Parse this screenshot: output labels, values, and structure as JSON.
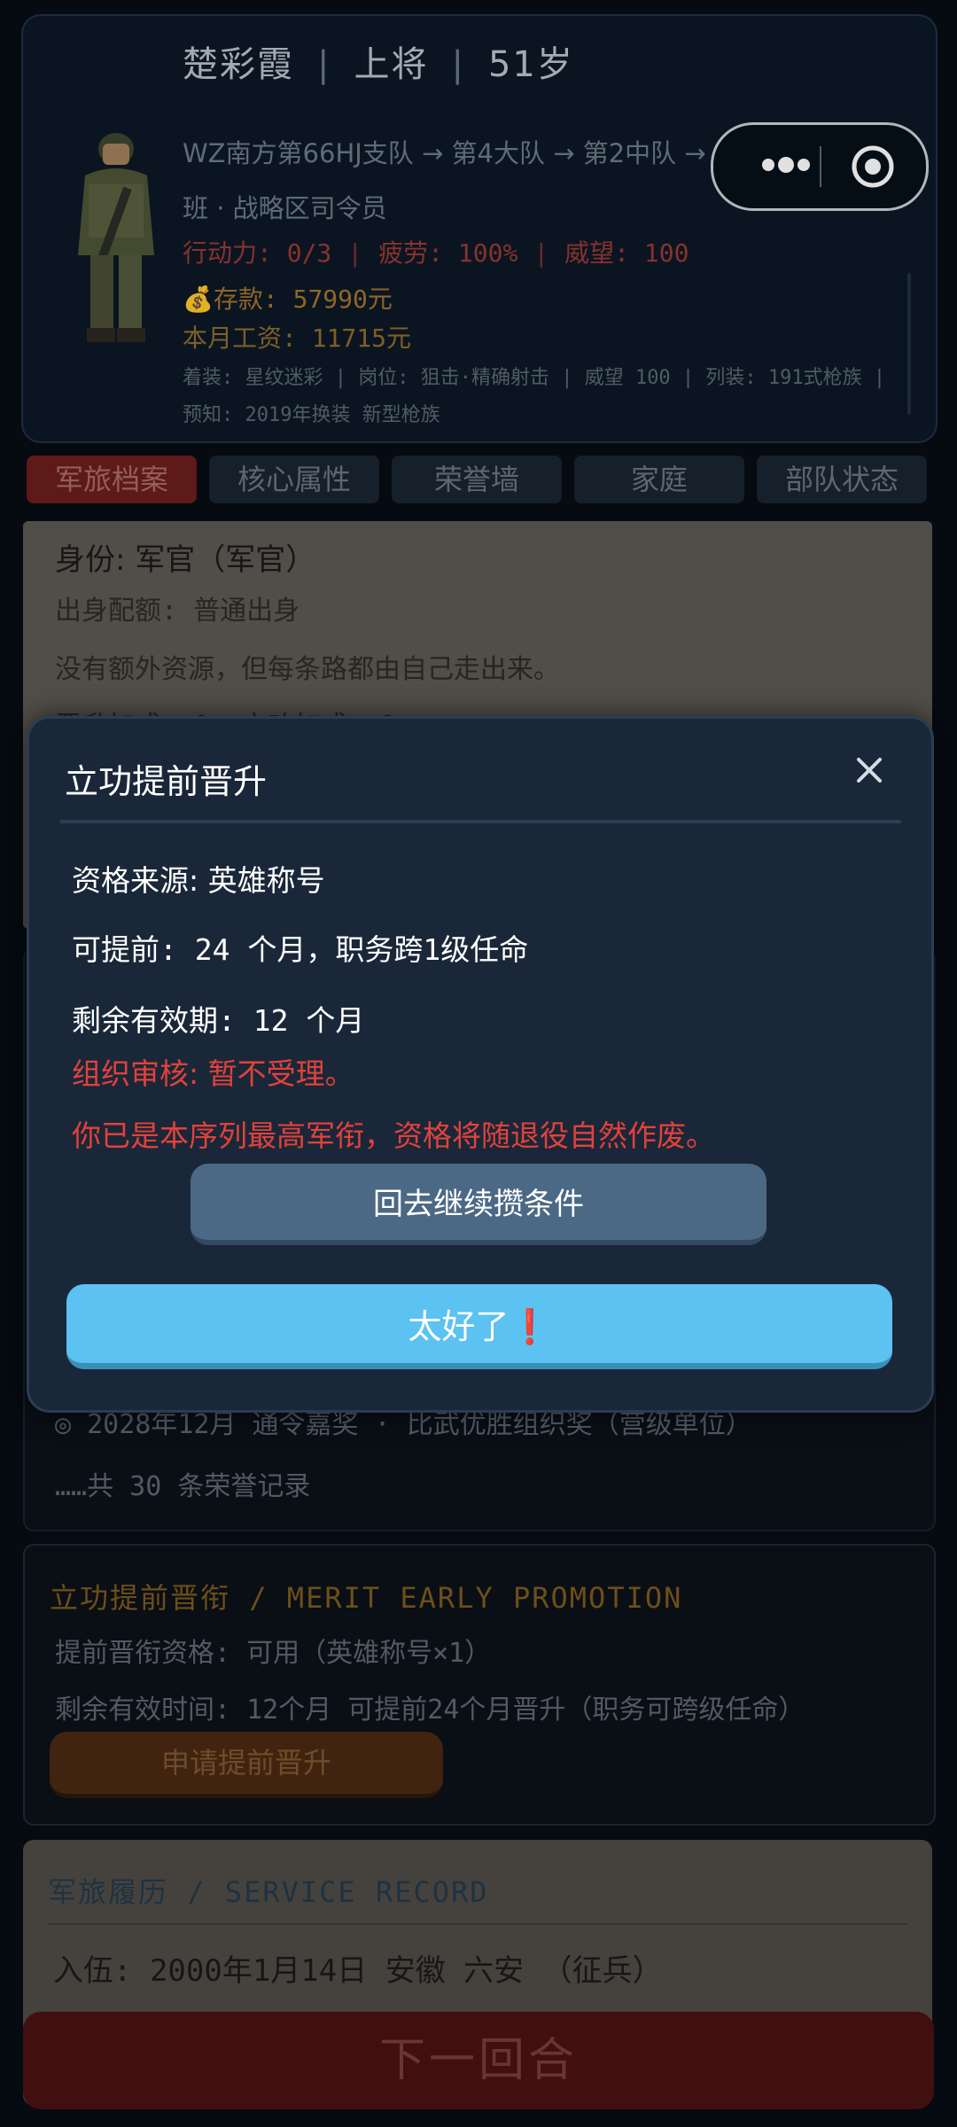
{
  "profile": {
    "name": "楚彩霞",
    "rank": "上将",
    "age": "51岁",
    "unit_line": "WZ南方第66HJ支队 → 第4大队 → 第2中队 → 第3排 → 第1",
    "unit_line2": "班 · 战略区司令员",
    "action": "行动力: 0/3",
    "fatigue": "疲劳: 100%",
    "prestige": "威望: 100",
    "savings_icon": "money-bag-icon",
    "savings": "存款: 57990元",
    "salary": "本月工资: 11715元",
    "equipment": "着装: 星纹迷彩 | 岗位: 狙击·精确射击 | 威望 100 | 列装: 191式枪族 |",
    "forecast": "预知: 2019年换装 新型枪族"
  },
  "tabs": [
    "军旅档案",
    "核心属性",
    "荣誉墙",
    "家庭",
    "部队状态"
  ],
  "archive": {
    "identity": "身份: 军官（军官）",
    "origin": "出身配额: 普通出身",
    "origin_desc": "没有额外资源，但每条路都由自己走出来。",
    "bonus": "晋升加成: 0%    立功加成: 0%"
  },
  "honors": {
    "last_record": "◎ 2028年12月 通令嘉奖 · 比武优胜组织奖（营级单位）",
    "total": "……共 30 条荣誉记录"
  },
  "merit": {
    "title": "立功提前晋衔 / MERIT EARLY PROMOTION",
    "eligibility": "提前晋衔资格: 可用（英雄称号×1）",
    "remaining": "剩余有效时间: 12个月   可提前24个月晋升（职务可跨级任命）",
    "apply_button": "申请提前晋升"
  },
  "service_record": {
    "title": "军旅履历 / SERVICE RECORD",
    "enlist": "入伍: 2000年1月14日   安徽 六安   （征兵）"
  },
  "next_turn_button": "下一回合",
  "modal": {
    "title": "立功提前晋升",
    "source": "资格来源: 英雄称号",
    "advance": "可提前: 24 个月，职务跨1级任命",
    "validity": "剩余有效期: 12 个月",
    "review": "组织审核: 暂不受理。",
    "note": "你已是本序列最高军衔，资格将随退役自然作废。",
    "secondary_button": "回去继续攒条件",
    "primary_button": "太好了❗"
  }
}
